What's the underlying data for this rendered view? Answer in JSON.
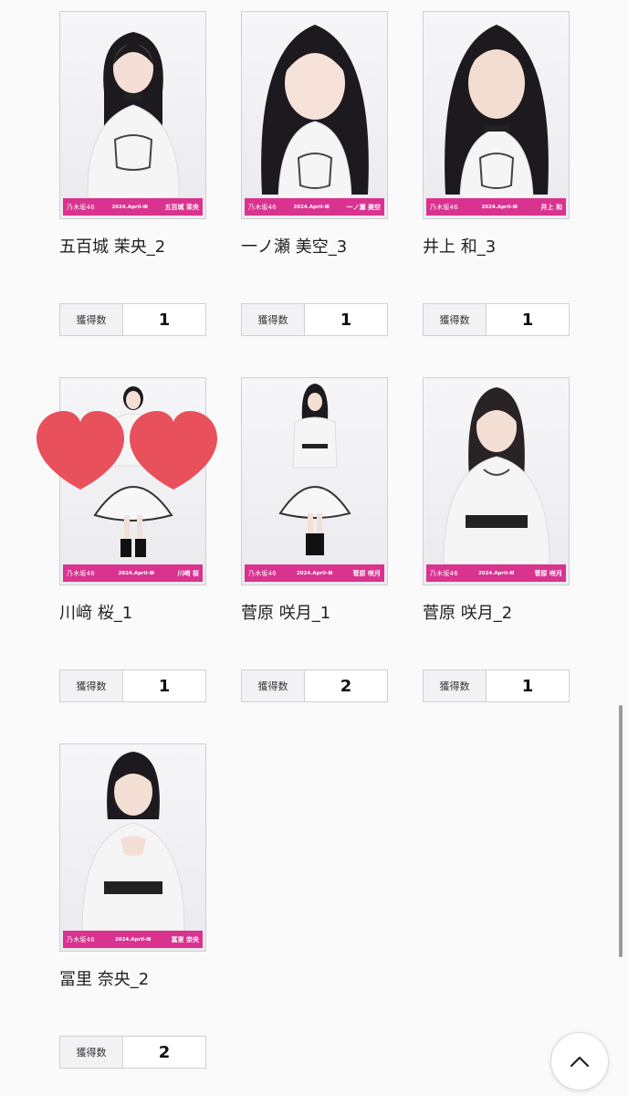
{
  "cards": [
    {
      "title": "五百城 茉央_2",
      "count_label": "獲得数",
      "count": "1",
      "band": {
        "brand": "乃木坂46",
        "date": "2024.April-Ⅲ",
        "name": "五百城 茉央"
      }
    },
    {
      "title": "一ノ瀬 美空_3",
      "count_label": "獲得数",
      "count": "1",
      "band": {
        "brand": "乃木坂46",
        "date": "2024.April-Ⅲ",
        "name": "一ノ瀬 美空"
      }
    },
    {
      "title": "井上 和_3",
      "count_label": "獲得数",
      "count": "1",
      "band": {
        "brand": "乃木坂46",
        "date": "2024.April-Ⅲ",
        "name": "井上 和"
      }
    },
    {
      "title": "川﨑 桜_1",
      "count_label": "獲得数",
      "count": "1",
      "band": {
        "brand": "乃木坂46",
        "date": "2024.April-Ⅲ",
        "name": "川﨑 桜"
      }
    },
    {
      "title": "菅原 咲月_1",
      "count_label": "獲得数",
      "count": "2",
      "band": {
        "brand": "乃木坂46",
        "date": "2024.April-Ⅲ",
        "name": "菅原 咲月"
      }
    },
    {
      "title": "菅原 咲月_2",
      "count_label": "獲得数",
      "count": "1",
      "band": {
        "brand": "乃木坂46",
        "date": "2024.April-Ⅲ",
        "name": "菅原 咲月"
      }
    },
    {
      "title": "冨里 奈央_2",
      "count_label": "獲得数",
      "count": "2",
      "band": {
        "brand": "乃木坂46",
        "date": "2024.April-Ⅲ",
        "name": "冨里 奈央"
      }
    }
  ],
  "colors": {
    "band": "#d9338f",
    "heart": "#e8505b",
    "background": "#fafafb"
  },
  "icons": {
    "to_top": "chevron-up-icon",
    "hearts": "heart-icon"
  }
}
